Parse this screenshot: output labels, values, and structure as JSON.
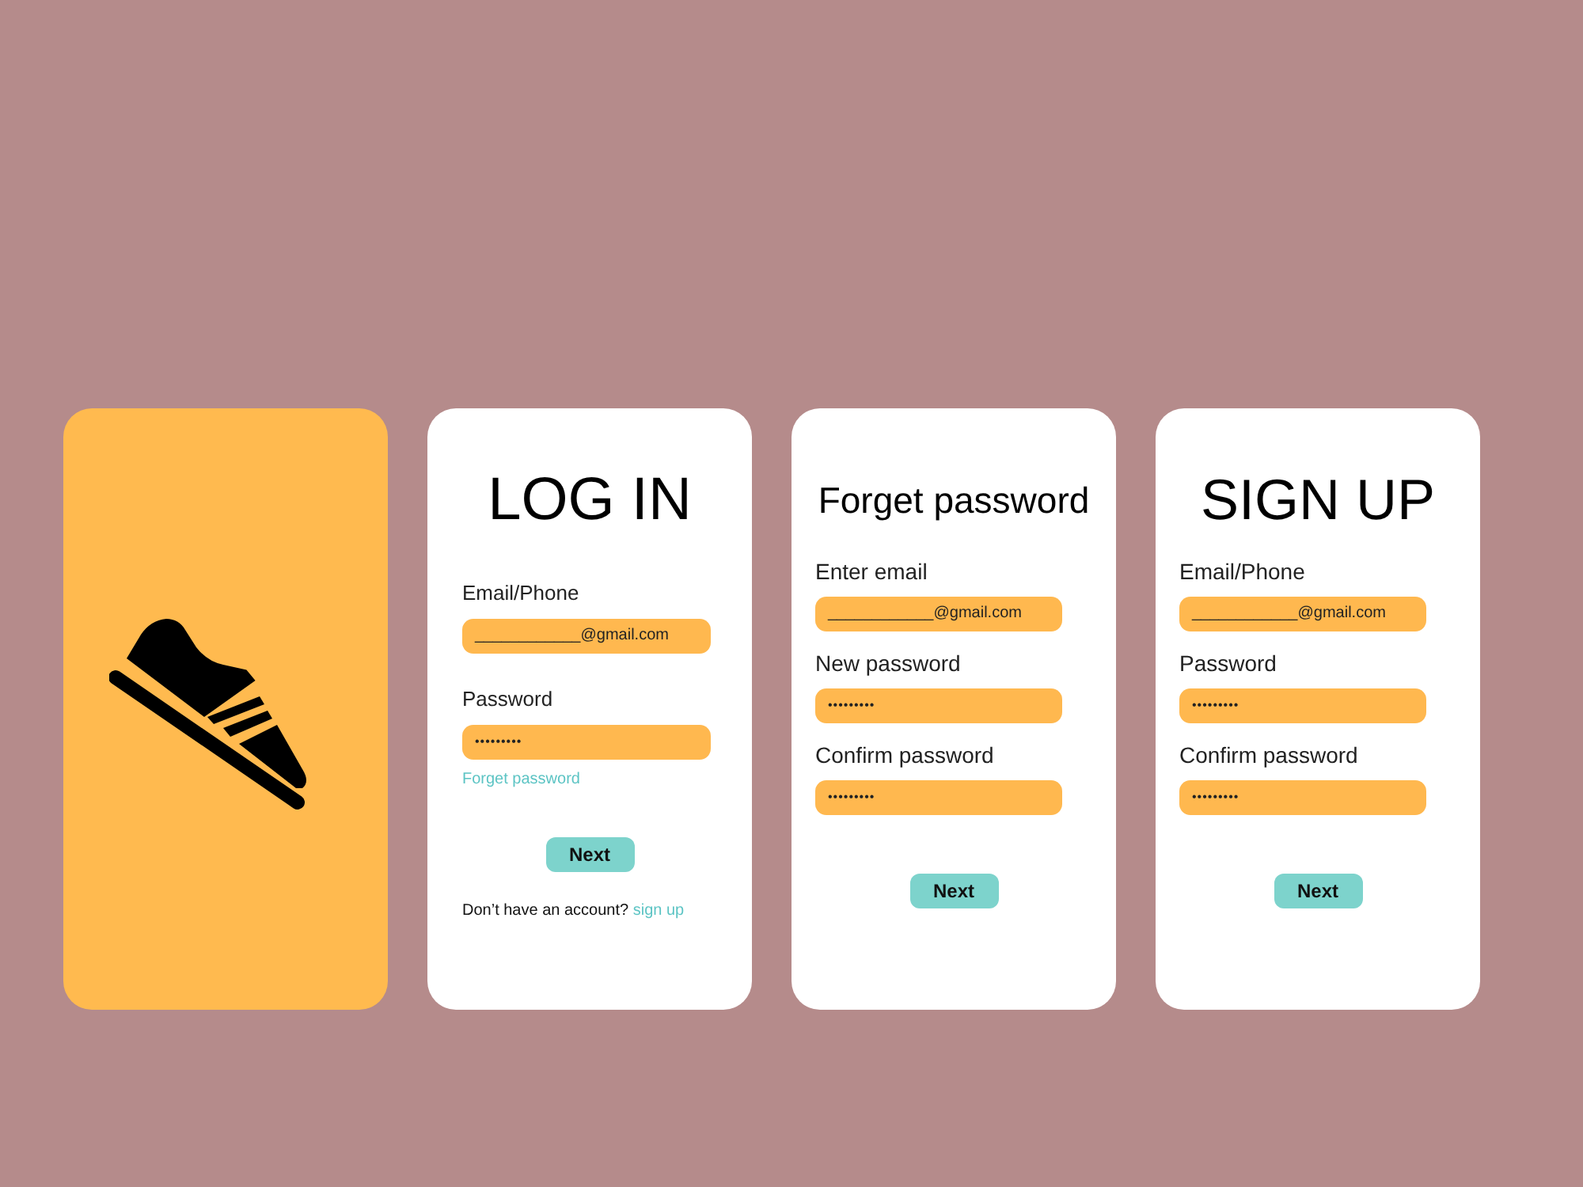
{
  "screens": [
    {
      "kind": "splash"
    },
    {
      "kind": "login",
      "title": "LOG IN",
      "fields": [
        {
          "kind": "text",
          "label": "Email/Phone",
          "value": "____________@gmail.com"
        },
        {
          "kind": "password",
          "label": "Password",
          "value": "•••••••••"
        }
      ],
      "link": "Forget password",
      "button": "Next",
      "footer": {
        "text": "Don’t have an account?",
        "link": "sign up"
      }
    },
    {
      "kind": "reset",
      "title": "Forget password",
      "fields": [
        {
          "kind": "text",
          "label": "Enter email",
          "value": "____________@gmail.com"
        },
        {
          "kind": "password",
          "label": "New password",
          "value": "•••••••••"
        },
        {
          "kind": "password",
          "label": "Confirm password",
          "value": "•••••••••"
        }
      ],
      "button": "Next"
    },
    {
      "kind": "signup",
      "title": "SIGN UP",
      "fields": [
        {
          "kind": "text",
          "label": "Email/Phone",
          "value": "____________@gmail.com"
        },
        {
          "kind": "password",
          "label": "Password",
          "value": "•••••••••"
        },
        {
          "kind": "password",
          "label": "Confirm password",
          "value": "•••••••••"
        }
      ],
      "button": "Next"
    }
  ]
}
